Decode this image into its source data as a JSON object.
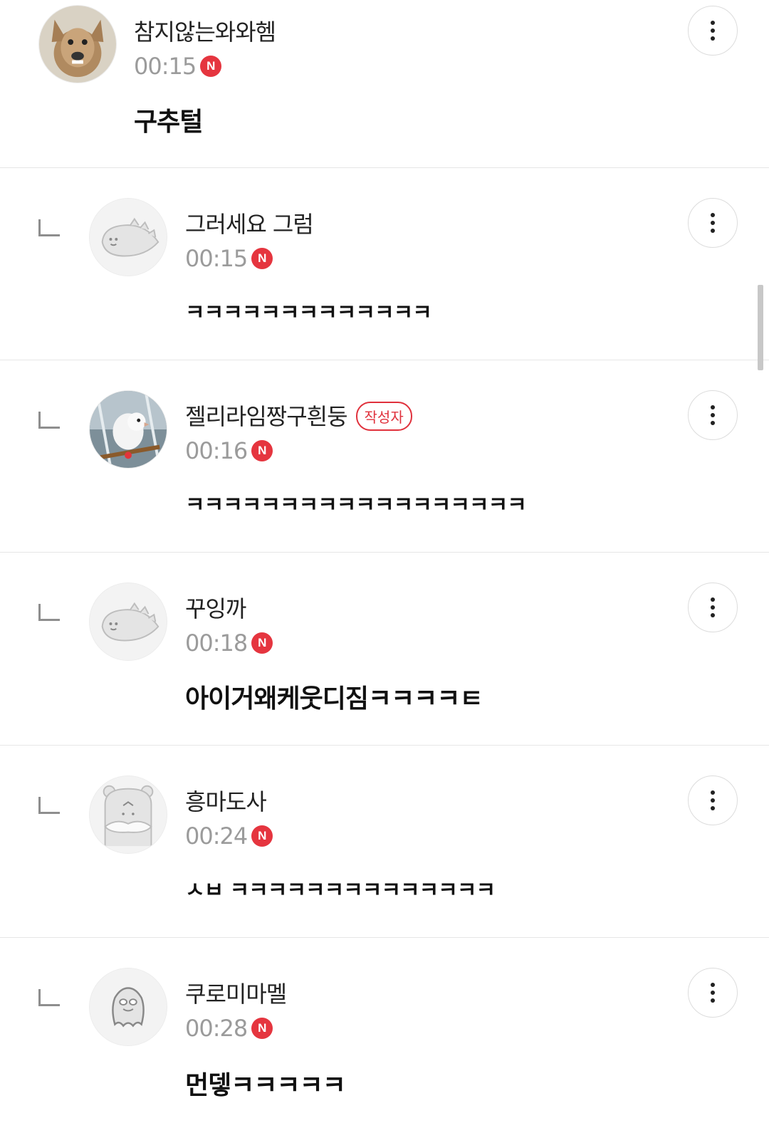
{
  "comments": [
    {
      "nickname": "참지않는와와헴",
      "time": "00:15",
      "badge": "N",
      "text": "구추털",
      "avatar": "dog-photo-avatar",
      "is_reply": false
    },
    {
      "nickname": "그러세요 그럼",
      "time": "00:15",
      "badge": "N",
      "text": "ㅋㅋㅋㅋㅋㅋㅋㅋㅋㅋㅋㅋㅋ",
      "avatar": "default-dino-avatar",
      "is_reply": true
    },
    {
      "nickname": "젤리라임짱구흰둥",
      "author_tag": "작성자",
      "time": "00:16",
      "badge": "N",
      "text": "ㅋㅋㅋㅋㅋㅋㅋㅋㅋㅋㅋㅋㅋㅋㅋㅋㅋㅋ",
      "avatar": "parrot-photo-avatar",
      "is_reply": true
    },
    {
      "nickname": "꾸잉까",
      "time": "00:18",
      "badge": "N",
      "text": "아이거왜케웃디짐ㅋㅋㅋㅋㅌ",
      "avatar": "default-dino-avatar",
      "is_reply": true
    },
    {
      "nickname": "흥마도사",
      "time": "00:24",
      "badge": "N",
      "text": "ㅅㅂ ㅋㅋㅋㅋㅋㅋㅋㅋㅋㅋㅋㅋㅋㅋ",
      "avatar": "default-bear-avatar",
      "is_reply": true
    },
    {
      "nickname": "쿠로미마멜",
      "time": "00:28",
      "badge": "N",
      "text": "먼뎋ㅋㅋㅋㅋㅋ",
      "avatar": "default-blob-avatar",
      "is_reply": true
    }
  ],
  "colors": {
    "new_badge": "#e5353f",
    "author_tag": "#e0313c",
    "divider": "#e6e6e6",
    "time": "#9b9b9b"
  },
  "icons": {
    "more": "more-vertical-icon",
    "reply": "reply-indent-icon"
  }
}
